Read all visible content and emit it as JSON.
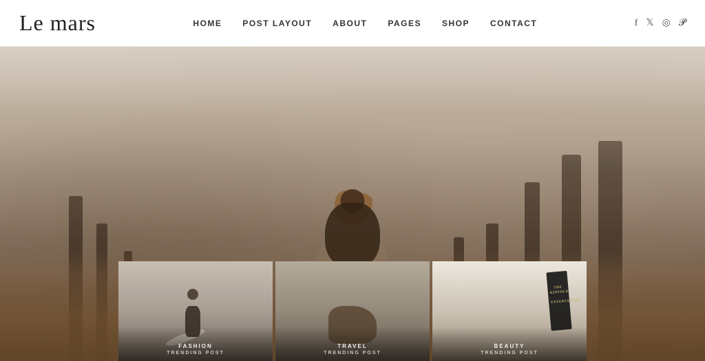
{
  "header": {
    "logo": "Le mars",
    "nav": {
      "items": [
        {
          "label": "HOME",
          "id": "home"
        },
        {
          "label": "POST LAYOUT",
          "id": "post-layout"
        },
        {
          "label": "ABOUT",
          "id": "about"
        },
        {
          "label": "PAGES",
          "id": "pages"
        },
        {
          "label": "SHOP",
          "id": "shop"
        },
        {
          "label": "CONTACT",
          "id": "contact"
        }
      ]
    },
    "social": {
      "facebook": "f",
      "twitter": "𝕏",
      "instagram": "◎",
      "pinterest": "𝓟"
    }
  },
  "cards": [
    {
      "category": "FASHION",
      "subtitle": "TRENDING POST",
      "id": "fashion-card"
    },
    {
      "category": "TRAVEL",
      "subtitle": "TRENDING POST",
      "id": "travel-card"
    },
    {
      "category": "BEAUTY",
      "subtitle": "TRENDING POST",
      "id": "beauty-card"
    }
  ],
  "book": {
    "title": "KINFOLK",
    "subtitle": "ENTERTAINER"
  }
}
